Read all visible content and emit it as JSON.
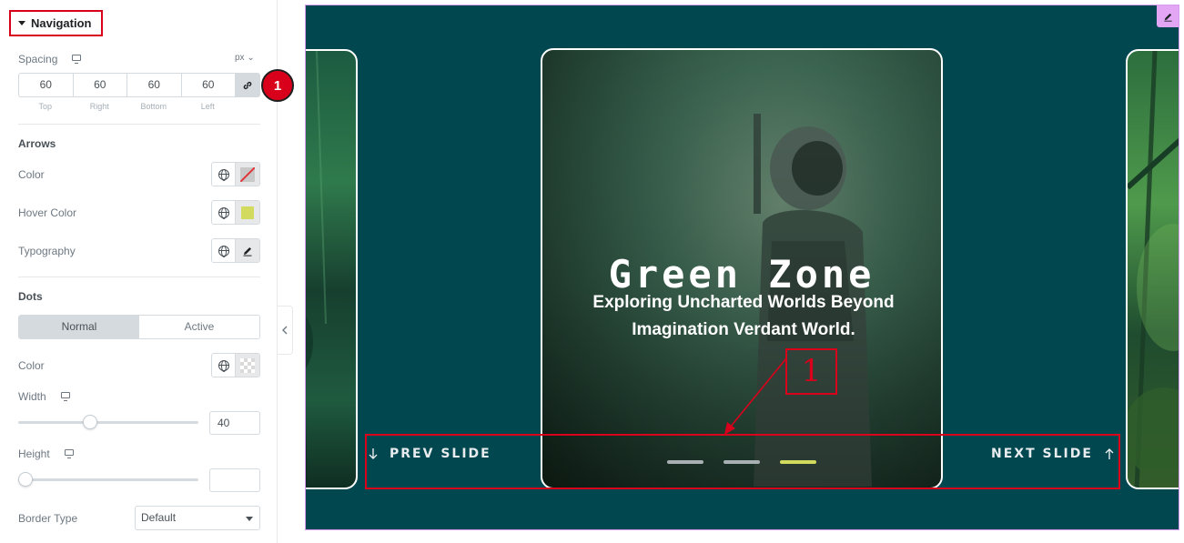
{
  "panel": {
    "section_title": "Navigation",
    "spacing": {
      "label": "Spacing",
      "unit": "px",
      "values": {
        "top": "60",
        "right": "60",
        "bottom": "60",
        "left": "60"
      },
      "labels": {
        "top": "Top",
        "right": "Right",
        "bottom": "Bottom",
        "left": "Left"
      }
    },
    "badge_number": "1",
    "arrows": {
      "title": "Arrows",
      "color_label": "Color",
      "hover_color_label": "Hover Color",
      "hover_color_value": "#d2db5e",
      "typography_label": "Typography"
    },
    "dots": {
      "title": "Dots",
      "tabs": [
        "Normal",
        "Active"
      ],
      "active_tab": "Normal",
      "color_label": "Color",
      "width_label": "Width",
      "width_value": "40",
      "width_slider_fraction": 0.4,
      "height_label": "Height",
      "height_value": "",
      "height_slider_fraction": 0.0,
      "border_type_label": "Border Type",
      "border_type_value": "Default"
    }
  },
  "preview": {
    "slide": {
      "title": "Green Zone",
      "subtitle_line1": "Exploring Uncharted Worlds Beyond",
      "subtitle_line2": "Imagination Verdant World."
    },
    "nav": {
      "prev_label": "PREV SLIDE",
      "next_label": "NEXT SLIDE",
      "dots_count": 3,
      "active_dot": 3
    },
    "callout_number": "1",
    "colors": {
      "canvas_bg": "#00474f",
      "accent_lime": "#d2db5e",
      "annotation_red": "#d9001b"
    }
  }
}
